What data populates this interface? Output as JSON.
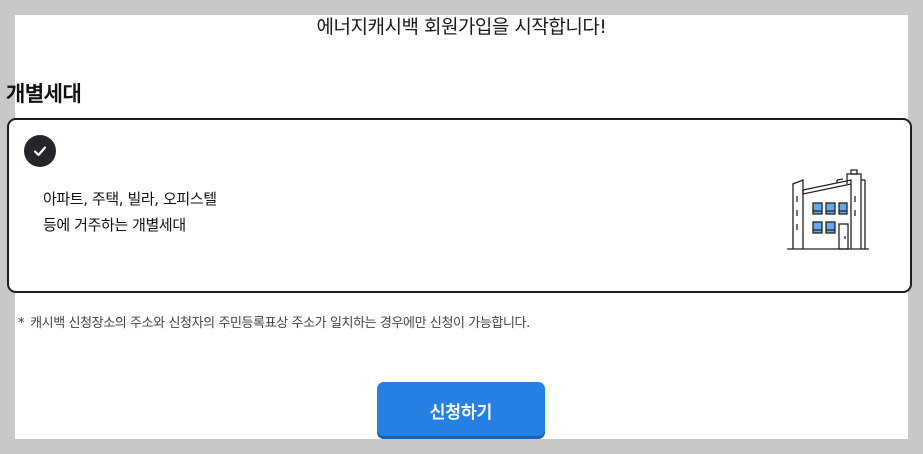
{
  "page": {
    "title": "에너지캐시백 회원가입을 시작합니다!"
  },
  "section": {
    "title": "개별세대"
  },
  "option": {
    "selected": true,
    "line1": "아파트, 주택, 빌라, 오피스텔",
    "line2": "등에 거주하는 개별세대",
    "check_icon": "check-icon",
    "illustration_icon": "building-icon"
  },
  "note": {
    "marker": "*",
    "text": "캐시백 신청장소의 주소와 신청자의 주민등록표상 주소가 일치하는 경우에만 신청이 가능합니다."
  },
  "actions": {
    "apply_label": "신청하기"
  },
  "colors": {
    "background": "#c8c8c8",
    "panel": "#ffffff",
    "primary": "#2680e4",
    "check_bg": "#25262b",
    "window_fill": "#64aaf0"
  }
}
